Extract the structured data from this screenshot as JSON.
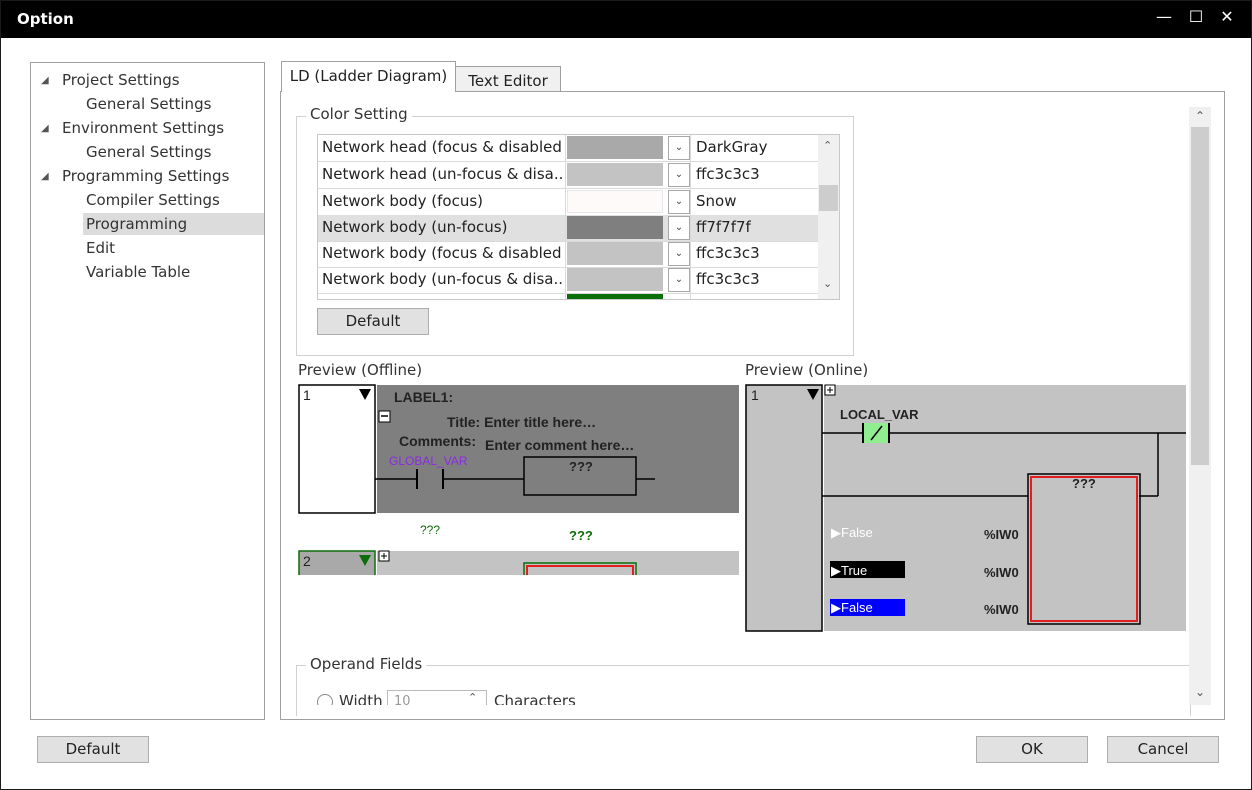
{
  "window": {
    "title": "Option",
    "minimize": "—",
    "maximize": "☐",
    "close": "✕"
  },
  "tree": {
    "items": [
      {
        "label": "Project Settings",
        "level": 0,
        "expanded": true
      },
      {
        "label": "General Settings",
        "level": 1
      },
      {
        "label": "Environment Settings",
        "level": 0,
        "expanded": true
      },
      {
        "label": "General Settings",
        "level": 1
      },
      {
        "label": "Programming Settings",
        "level": 0,
        "expanded": true
      },
      {
        "label": "Compiler Settings",
        "level": 1
      },
      {
        "label": "Programming",
        "level": 1,
        "selected": true
      },
      {
        "label": "Edit",
        "level": 1
      },
      {
        "label": "Variable Table",
        "level": 1
      }
    ],
    "expand_icon": "◢"
  },
  "tabs": [
    {
      "label": "LD (Ladder Diagram)",
      "active": true
    },
    {
      "label": "Text Editor",
      "active": false
    }
  ],
  "color_setting": {
    "title": "Color Setting",
    "rows": [
      {
        "name": "Network head (focus & disabled)",
        "color": "#a9a9a9",
        "value": "DarkGray"
      },
      {
        "name": "Network head (un-focus & disa...",
        "color": "#c3c3c3",
        "value": "ffc3c3c3"
      },
      {
        "name": "Network body (focus)",
        "color": "#fffafa",
        "value": "Snow"
      },
      {
        "name": "Network body (un-focus)",
        "color": "#7f7f7f",
        "value": "ff7f7f7f",
        "selected": true
      },
      {
        "name": "Network body (focus & disabled)",
        "color": "#c3c3c3",
        "value": "ffc3c3c3"
      },
      {
        "name": "Network body (un-focus & disa...",
        "color": "#c3c3c3",
        "value": "ffc3c3c3"
      }
    ],
    "default_button": "Default"
  },
  "preview_offline": {
    "title": "Preview (Offline)",
    "net1_number": "1",
    "label": "LABEL1:",
    "title_text": "Title: Enter title here…",
    "comments_label": "Comments:",
    "comments_text": "Enter comment here…",
    "global_var": "GLOBAL_VAR",
    "fb1": "???",
    "net2_number": "2",
    "contact2": "???",
    "fb2": "???"
  },
  "preview_online": {
    "title": "Preview (Online)",
    "net_number": "1",
    "local_var": "LOCAL_VAR",
    "fb": "???",
    "inputs": [
      {
        "state": "▶False",
        "addr": "%IW0",
        "active": false
      },
      {
        "state": "▶True",
        "addr": "%IW0",
        "active": true
      },
      {
        "state": "▶False",
        "addr": "%IW0",
        "active": false
      }
    ]
  },
  "operand_fields": {
    "title": "Operand Fields",
    "width_label": "Width",
    "width_value": "10",
    "characters_label": "Characters"
  },
  "footer": {
    "default": "Default",
    "ok": "OK",
    "cancel": "Cancel"
  }
}
